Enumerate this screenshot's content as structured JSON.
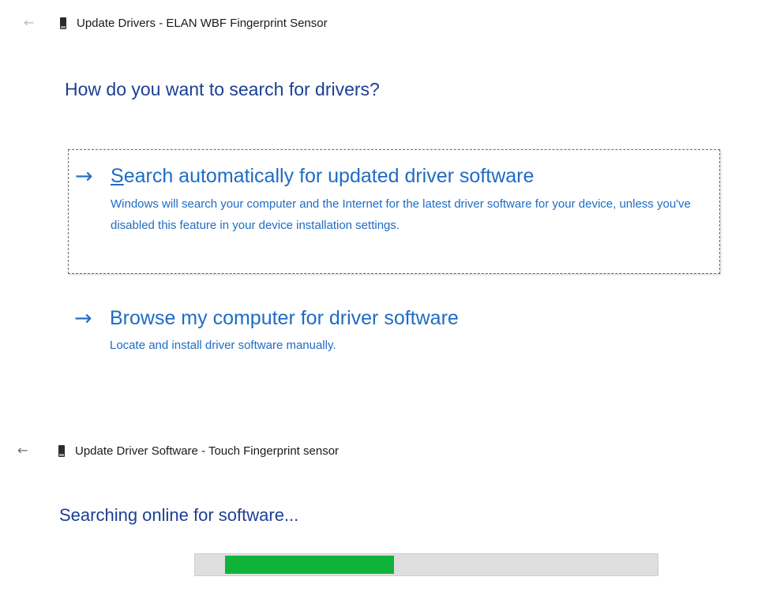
{
  "panel1": {
    "window_title": "Update Drivers - ELAN WBF Fingerprint Sensor",
    "back_icon": "back-arrow-icon",
    "device_icon": "fingerprint-device-icon",
    "heading": "How do you want to search for drivers?",
    "options": [
      {
        "arrow": "→",
        "title_first": "S",
        "title_rest": "earch automatically for updated driver software",
        "description": "Windows will search your computer and the Internet for the latest driver software for your device, unless you've disabled this feature in your device installation settings.",
        "selected": true
      },
      {
        "arrow": "→",
        "title": "Browse my computer for driver software",
        "description": "Locate and install driver software manually.",
        "selected": false
      }
    ]
  },
  "panel2": {
    "window_title": "Update Driver Software - Touch Fingerprint sensor",
    "back_icon": "back-arrow-icon",
    "device_icon": "fingerprint-device-icon",
    "heading": "Searching online for software...",
    "progress": {
      "segment_start": 0.065,
      "segment_end": 0.43,
      "fill_color": "#10b33a",
      "track_color": "#dedede"
    }
  },
  "colors": {
    "heading": "#1c3f94",
    "link": "#1f6cc4"
  }
}
